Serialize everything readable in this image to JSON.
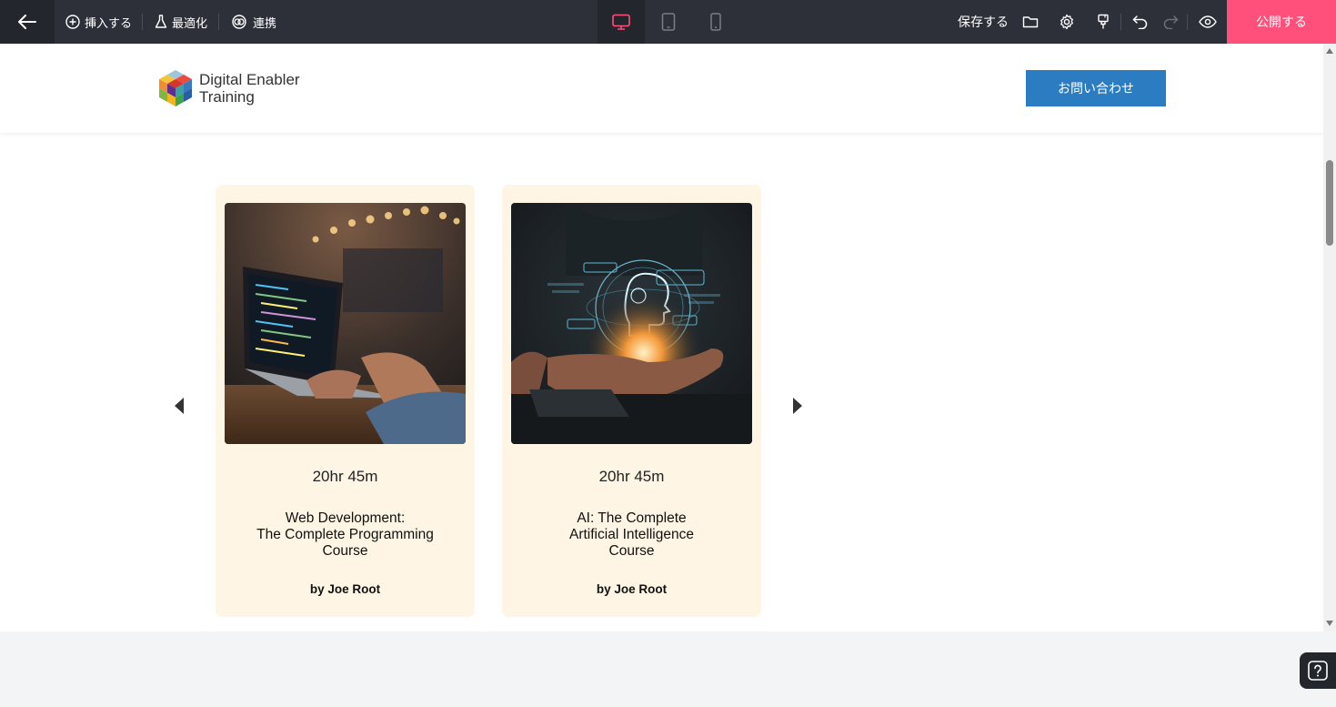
{
  "toolbar": {
    "insert_label": "挿入する",
    "optimize_label": "最適化",
    "integrate_label": "連携",
    "save_label": "保存する",
    "publish_label": "公開する",
    "accent_color": "#ff4f7b",
    "background_color": "#2d3039",
    "active_device": "desktop"
  },
  "site": {
    "logo_line1": "Digital Enabler",
    "logo_line2": "Training",
    "contact_label": "お問い合わせ",
    "contact_color": "#2b7cc0"
  },
  "courses": [
    {
      "duration": "20hr 45m",
      "title_lines": [
        "Web Development:",
        "The Complete Programming",
        "Course"
      ],
      "author": "by Joe Root",
      "image": "laptop-coding-photo"
    },
    {
      "duration": "20hr 45m",
      "title_lines": [
        "AI: The Complete",
        "Artificial Intelligence",
        "Course"
      ],
      "author": "by Joe Root",
      "image": "ai-brain-hologram-photo"
    }
  ],
  "card_color": "#fff5e4"
}
